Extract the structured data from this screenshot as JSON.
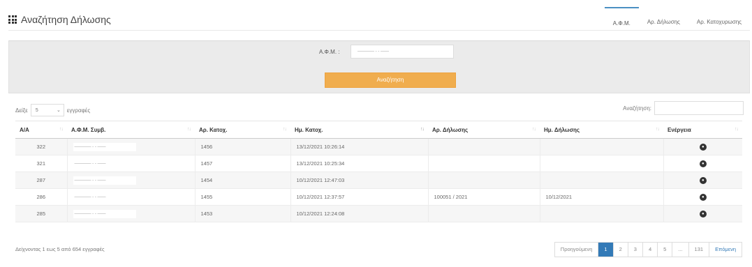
{
  "header": {
    "title": "Αναζήτηση Δήλωσης",
    "tabs": [
      "Α.Φ.Μ.",
      "Αρ. Δήλωσης",
      "Αρ. Κατοχυρωσης"
    ],
    "active_tab": 0
  },
  "search": {
    "afm_label": "Α.Φ.Μ. :",
    "afm_value": "———— - - ——",
    "button_label": "Αναζήτηση",
    "button_color": "#f0ad4e"
  },
  "table_controls": {
    "show_label": "Δείξε",
    "page_length": "5",
    "records_label": "εγγραφές",
    "filter_label": "Αναζήτηση:"
  },
  "table": {
    "columns": [
      "Α/Α",
      "Α.Φ.Μ. Συμβ.",
      "Αρ. Κατοχ.",
      "Ημ. Κατοχ.",
      "Αρ. Δήλωσης",
      "Ημ. Δήλωσης",
      "Ενέργεια"
    ],
    "rows": [
      {
        "aa": "322",
        "afm": "———— - - ——",
        "ar_katox": "1456",
        "im_katox": "13/12/2021 10:26:14",
        "ar_dilosis": "",
        "im_dilosis": ""
      },
      {
        "aa": "321",
        "afm": "———— - - ——",
        "ar_katox": "1457",
        "im_katox": "13/12/2021 10:25:34",
        "ar_dilosis": "",
        "im_dilosis": ""
      },
      {
        "aa": "287",
        "afm": "———— - - ——",
        "ar_katox": "1454",
        "im_katox": "10/12/2021 12:47:03",
        "ar_dilosis": "",
        "im_dilosis": ""
      },
      {
        "aa": "286",
        "afm": "———— - - ——",
        "ar_katox": "1455",
        "im_katox": "10/12/2021 12:37:57",
        "ar_dilosis": "100051 / 2021",
        "im_dilosis": "10/12/2021"
      },
      {
        "aa": "285",
        "afm": "———— - - ——",
        "ar_katox": "1453",
        "im_katox": "10/12/2021 12:24:08",
        "ar_dilosis": "",
        "im_dilosis": ""
      }
    ],
    "action_icon": "view-icon"
  },
  "footer": {
    "info": "Δείχνοντας 1 εως 5 από 654 εγγραφές",
    "pagination": [
      "Προηγούμενη",
      "1",
      "2",
      "3",
      "4",
      "5",
      "...",
      "131",
      "Επόμενη"
    ],
    "current_page": "1"
  },
  "colors": {
    "accent": "#337ab7",
    "tab_border": "#4a90c2",
    "panel_bg": "#ebebeb"
  }
}
